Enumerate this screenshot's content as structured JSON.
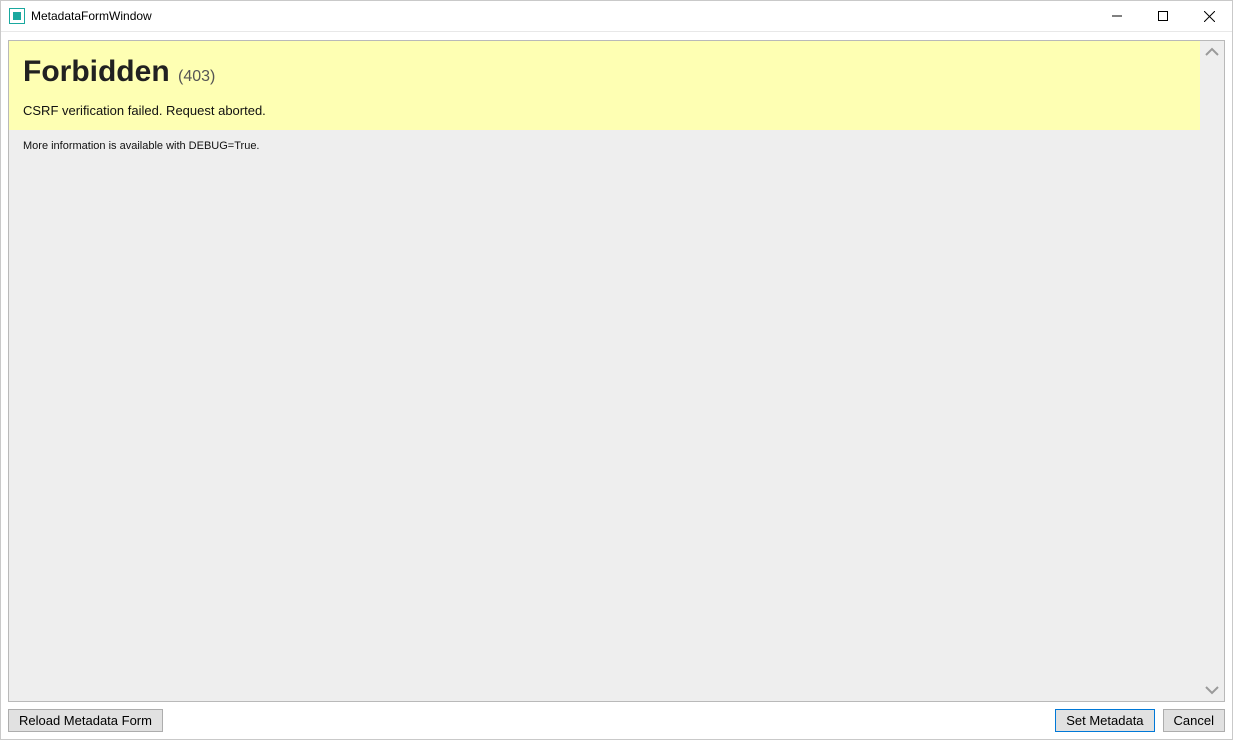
{
  "window": {
    "title": "MetadataFormWindow"
  },
  "error": {
    "heading": "Forbidden",
    "code": "(403)",
    "message": "CSRF verification failed. Request aborted.",
    "debug_info": "More information is available with DEBUG=True."
  },
  "buttons": {
    "reload": "Reload Metadata Form",
    "set_metadata": "Set Metadata",
    "cancel": "Cancel"
  }
}
